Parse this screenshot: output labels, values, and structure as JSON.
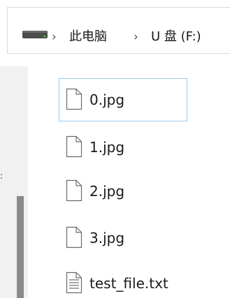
{
  "address_bar": {
    "drive_icon": "usb-drive-icon",
    "separator": "›",
    "breadcrumbs": [
      "此电脑",
      "U 盘 (F:)"
    ]
  },
  "files": [
    {
      "name": "0.jpg",
      "icon": "image-file-icon",
      "selected": true
    },
    {
      "name": "1.jpg",
      "icon": "image-file-icon",
      "selected": false
    },
    {
      "name": "2.jpg",
      "icon": "image-file-icon",
      "selected": false
    },
    {
      "name": "3.jpg",
      "icon": "image-file-icon",
      "selected": false
    },
    {
      "name": "test_file.txt",
      "icon": "text-file-icon",
      "selected": false
    }
  ],
  "colors": {
    "selection_border": "#99c9ef",
    "nav_background": "#f1f1f1",
    "scrollbar_thumb": "#8a8a8a"
  },
  "nav_pane": {
    "edge_text": ":"
  }
}
